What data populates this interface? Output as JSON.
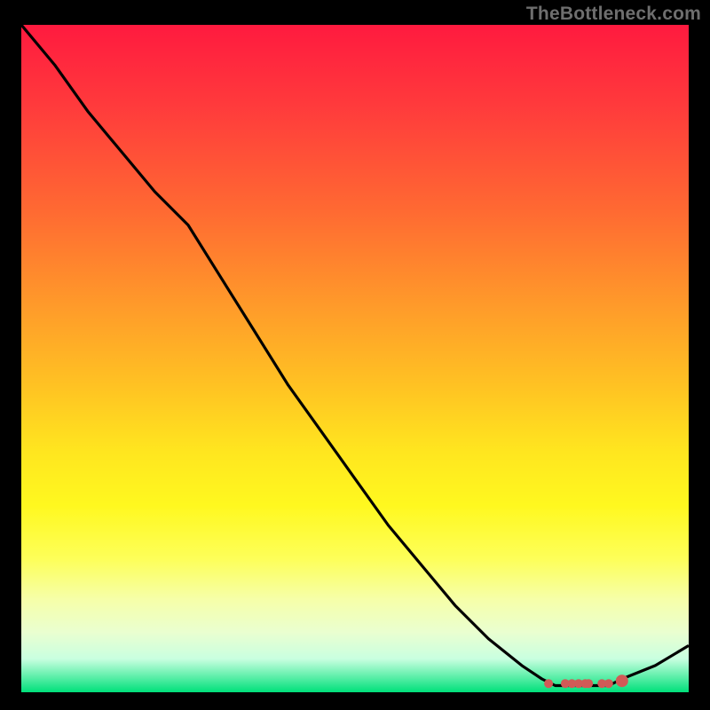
{
  "watermark": "TheBottleneck.com",
  "chart_data": {
    "type": "line",
    "title": "",
    "xlabel": "",
    "ylabel": "",
    "x": [
      0.0,
      0.05,
      0.1,
      0.15,
      0.2,
      0.25,
      0.3,
      0.35,
      0.4,
      0.45,
      0.5,
      0.55,
      0.6,
      0.65,
      0.7,
      0.75,
      0.78,
      0.8,
      0.83,
      0.85,
      0.88,
      0.9,
      0.95,
      1.0
    ],
    "values": [
      1.0,
      0.94,
      0.87,
      0.81,
      0.75,
      0.7,
      0.62,
      0.54,
      0.46,
      0.39,
      0.32,
      0.25,
      0.19,
      0.13,
      0.08,
      0.04,
      0.02,
      0.01,
      0.01,
      0.01,
      0.01,
      0.02,
      0.04,
      0.07
    ],
    "xlim": [
      0,
      1
    ],
    "ylim": [
      0,
      1
    ],
    "grid": false,
    "legend": false,
    "markers": {
      "x": [
        0.79,
        0.815,
        0.825,
        0.835,
        0.845,
        0.85,
        0.87,
        0.88,
        0.9
      ],
      "y": [
        0.013,
        0.013,
        0.013,
        0.013,
        0.013,
        0.013,
        0.013,
        0.013,
        0.017
      ],
      "r": [
        5,
        5,
        5,
        5,
        5,
        5,
        5,
        5,
        7
      ]
    }
  },
  "colors": {
    "background": "#000000",
    "curve": "#000000",
    "marker": "#d15a57",
    "watermark": "#6e6e6e"
  }
}
